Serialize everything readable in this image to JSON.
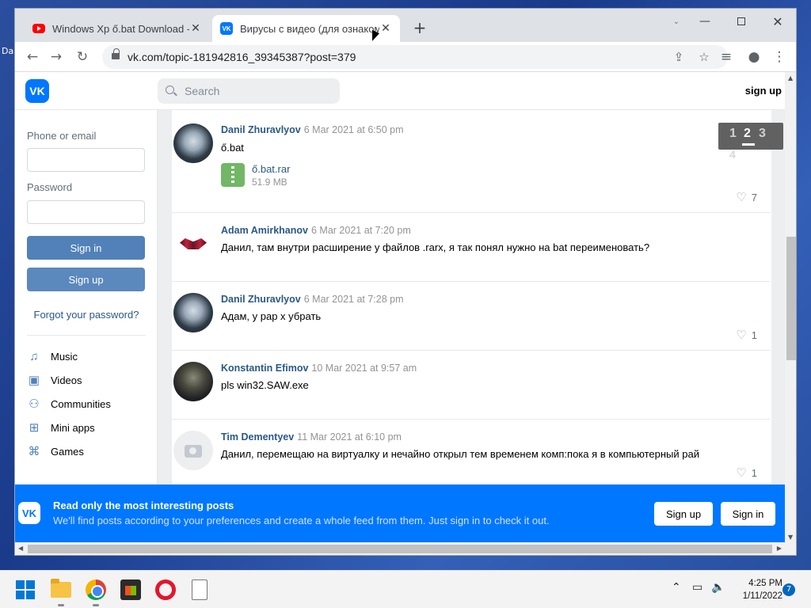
{
  "desktop": {
    "label_fragment": "Da"
  },
  "browser": {
    "tabs": [
      {
        "title": "Windows Xp ő.bat Download - Y",
        "favicon": "youtube-icon",
        "active": false
      },
      {
        "title": "Вирусы с видео (для ознакомл",
        "favicon": "vk-icon",
        "active": true
      }
    ],
    "url": "vk.com/topic-181942816_39345387?post=379"
  },
  "vk": {
    "logo_text": "VK",
    "search_placeholder": "Search",
    "signup_top": "sign up",
    "login": {
      "phone_label": "Phone or email",
      "password_label": "Password",
      "signin": "Sign in",
      "signup": "Sign up",
      "forgot": "Forgot your password?"
    },
    "menu": [
      {
        "label": "Music",
        "icon": "music-icon"
      },
      {
        "label": "Videos",
        "icon": "video-icon"
      },
      {
        "label": "Communities",
        "icon": "communities-icon"
      },
      {
        "label": "Mini apps",
        "icon": "apps-icon"
      },
      {
        "label": "Games",
        "icon": "gamepad-icon"
      }
    ],
    "pager": {
      "pages": [
        "1",
        "2",
        "3",
        "4"
      ],
      "current": "2"
    },
    "posts": [
      {
        "author": "Danil Zhuravlyov",
        "date": "6 Mar 2021 at 6:50 pm",
        "text": "ő.bat",
        "attachment": {
          "name": "ő.bat.rar",
          "size": "51.9 MB"
        },
        "likes": "7"
      },
      {
        "author": "Adam Amirkhanov",
        "date": "6 Mar 2021 at 7:20 pm",
        "text": "Данил, там внутри расширение у файлов .rarx, я так понял нужно на bat переименовать?",
        "likes": ""
      },
      {
        "author": "Danil Zhuravlyov",
        "date": "6 Mar 2021 at 7:28 pm",
        "text": "Адам, у рар х убрать",
        "likes": "1"
      },
      {
        "author": "Konstantin Efimov",
        "date": "10 Mar 2021 at 9:57 am",
        "text": "pls win32.SAW.exe",
        "likes": ""
      },
      {
        "author": "Tim Dementyev",
        "date": "11 Mar 2021 at 6:10 pm",
        "text": "Данил, перемещаю на виртуалку и нечайно открыл тем временем комп:пока я в компьютерный рай",
        "likes": "1"
      }
    ],
    "banner": {
      "title": "Read only the most interesting posts",
      "subtitle": "We'll find posts according to your preferences and create a whole feed from them. Just sign in to check it out.",
      "signup": "Sign up",
      "signin": "Sign in"
    }
  },
  "taskbar": {
    "time": "4:25 PM",
    "date": "1/11/2022",
    "notifications": "7"
  }
}
